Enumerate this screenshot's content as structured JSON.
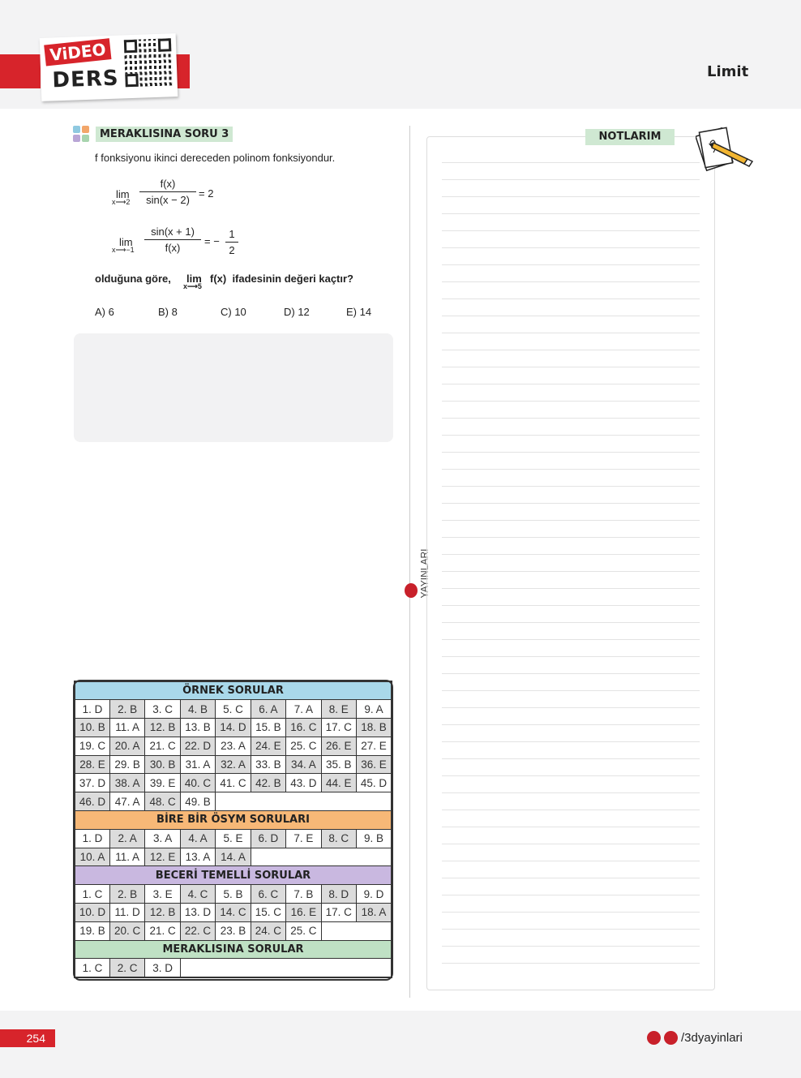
{
  "header": {
    "badge_video": "ViDEO",
    "badge_ders": "DERS",
    "chapter": "Limit"
  },
  "question": {
    "tag": "MERAKLISINA SORU 3",
    "intro": "f fonksiyonu ikinci dereceden polinom fonksiyondur.",
    "eq1": {
      "lim": "lim",
      "sub": "x⟶2",
      "num": "f(x)",
      "den": "sin(x − 2)",
      "rhs": "= 2"
    },
    "eq2": {
      "lim": "lim",
      "sub": "x⟶−1",
      "num": "sin(x + 1)",
      "den": "f(x)",
      "rhs": "= −",
      "rhs_num": "1",
      "rhs_den": "2"
    },
    "prompt_a": "olduğuna göre,",
    "prompt_lim": "lim",
    "prompt_sub": "x⟶5",
    "prompt_b": "f(x)  ifadesinin değeri kaçtır?",
    "options": [
      "A) 6",
      "B) 8",
      "C) 10",
      "D) 12",
      "E) 14"
    ]
  },
  "sidebar": {
    "brand": "YAYINLARI"
  },
  "notes": {
    "title": "NOTLARIM"
  },
  "answer_key": [
    {
      "title": "ÖRNEK SORULAR",
      "color": "#a9d8ea",
      "answers": [
        "D",
        "B",
        "C",
        "B",
        "C",
        "A",
        "A",
        "E",
        "A",
        "B",
        "A",
        "B",
        "B",
        "D",
        "B",
        "C",
        "C",
        "B",
        "C",
        "A",
        "C",
        "D",
        "A",
        "E",
        "C",
        "E",
        "E",
        "E",
        "B",
        "B",
        "A",
        "A",
        "B",
        "A",
        "B",
        "E",
        "D",
        "A",
        "E",
        "C",
        "C",
        "B",
        "D",
        "E",
        "D",
        "D",
        "A",
        "C",
        "B"
      ]
    },
    {
      "title": "BİRE BİR ÖSYM SORULARI",
      "color": "#f7b877",
      "answers": [
        "D",
        "A",
        "A",
        "A",
        "E",
        "D",
        "E",
        "C",
        "B",
        "A",
        "A",
        "E",
        "A",
        "A"
      ]
    },
    {
      "title": "BECERİ TEMELLİ SORULAR",
      "color": "#c9b8e0",
      "answers": [
        "C",
        "B",
        "E",
        "C",
        "B",
        "C",
        "B",
        "D",
        "D",
        "D",
        "D",
        "B",
        "D",
        "C",
        "C",
        "E",
        "C",
        "A",
        "B",
        "C",
        "C",
        "C",
        "B",
        "C",
        "C"
      ]
    },
    {
      "title": "MERAKLISINA SORULAR",
      "color": "#bfe1c4",
      "answers": [
        "C",
        "C",
        "D"
      ]
    }
  ],
  "footer": {
    "page": "254",
    "social": "/3dyayinlari"
  }
}
